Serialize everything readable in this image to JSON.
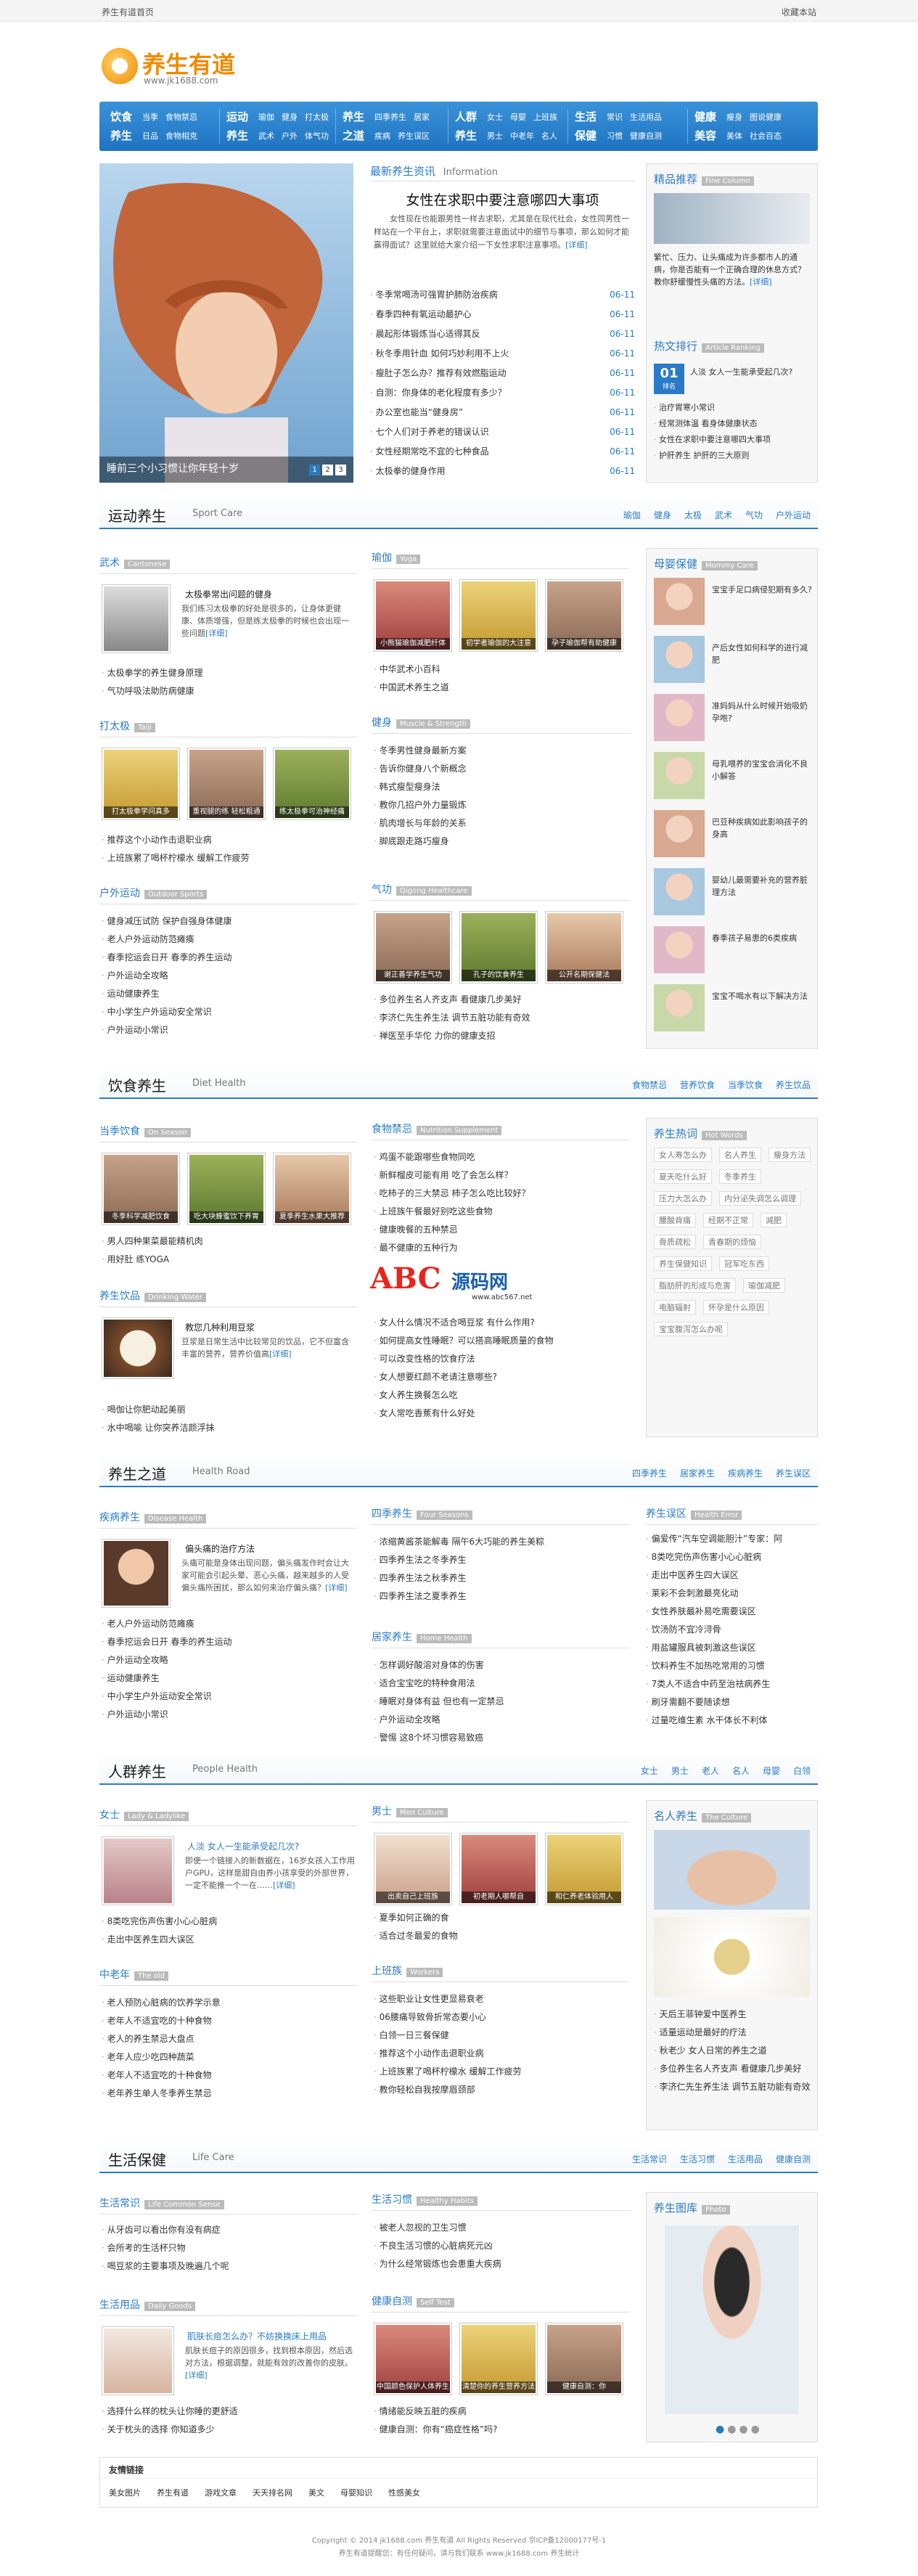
{
  "topbar": {
    "left": "养生有道首页",
    "right": "收藏本站"
  },
  "logo": {
    "name": "养生有道",
    "url": "www.jk1688.com"
  },
  "nav": [
    {
      "t1": "饮食",
      "t2": "养生",
      "i1": [
        "当季",
        "食物禁忌"
      ],
      "i2": [
        "日品",
        "食物相克"
      ]
    },
    {
      "t1": "运动",
      "t2": "养生",
      "i1": [
        "瑜伽",
        "健身",
        "打太极"
      ],
      "i2": [
        "武术",
        "户外",
        "体气功"
      ]
    },
    {
      "t1": "养生",
      "t2": "之道",
      "i1": [
        "四季养生",
        "居家"
      ],
      "i2": [
        "疾病",
        "养生误区"
      ]
    },
    {
      "t1": "人群",
      "t2": "养生",
      "i1": [
        "女士",
        "母婴",
        "上班族"
      ],
      "i2": [
        "男士",
        "中老年",
        "名人"
      ]
    },
    {
      "t1": "生活",
      "t2": "保健",
      "i1": [
        "常识",
        "生活用品"
      ],
      "i2": [
        "习惯",
        "健康自测"
      ]
    },
    {
      "t1": "健康",
      "t2": "美容",
      "i1": [
        "瘦身",
        "图说健康"
      ],
      "i2": [
        "美体",
        "社会百态"
      ]
    }
  ],
  "hero": {
    "caption": "睡前三个小习惯让你年轻十岁",
    "pages": [
      "1",
      "2",
      "3"
    ]
  },
  "latest": {
    "title": "最新养生资讯",
    "en": "Information",
    "headline": "女性在求职中要注意哪四大事项",
    "summary": "女性现在也能跟男性一样去求职，尤其是在现代社会，女性同男性一样站在一个平台上，求职就需要注意面试中的细节与事项，那么如何才能赢得面试？这里就给大家介绍一下女性求职注意事项。",
    "more": "[详细]",
    "items": [
      {
        "t": "冬季常喝汤可强胃护肺防治疾病",
        "d": "06-11"
      },
      {
        "t": "春季四种有氧运动最护心",
        "d": "06-11"
      },
      {
        "t": "晨起形体锻炼当心适得其反",
        "d": "06-11"
      },
      {
        "t": "秋冬季用针血 如何巧妙利用不上火",
        "d": "06-11"
      },
      {
        "t": "瘦肚子怎么办？推荐有效燃脂运动",
        "d": "06-11"
      },
      {
        "t": "自测：你身体的老化程度有多少？",
        "d": "06-11"
      },
      {
        "t": "办公室也能当“健身房”",
        "d": "06-11"
      },
      {
        "t": "七个人们对于养老的错误认识",
        "d": "06-11"
      },
      {
        "t": "女性经期常吃不宜的七种食品",
        "d": "06-11"
      },
      {
        "t": "太极拳的健身作用",
        "d": "06-11"
      }
    ]
  },
  "recommend": {
    "title": "精品推荐",
    "en": "Fine Column",
    "headline": "繁忙、压力、让头痛成为许多都市人的通病，你是否能有一个正确合理的休息方式？教你舒缓慢性头痛的方法。",
    "more": "[详细]"
  },
  "hot": {
    "title": "热文排行",
    "en": "Article Ranking",
    "top": {
      "num": "01",
      "label": "排名",
      "text": "人淡 女人一生能承受起几次?"
    },
    "items": [
      "治疗胃寒小常识",
      "经常测体温 看身体健康状态",
      "女性在求职中要注意哪四大事项",
      "护肝养生 护肝的三大原则"
    ]
  },
  "sport": {
    "title": "运动养生",
    "en": "Sport Care",
    "links": [
      "瑜伽",
      "健身",
      "太极",
      "武术",
      "气功",
      "户外运动"
    ],
    "wushu": {
      "h": "武术",
      "en": "Cantonese",
      "title": "太极拳常出问题的健身",
      "desc": "我们练习太极拳的好处是很多的，让身体更健康、体质增强，但是练太极拳的时候也会出现一些问题",
      "more": "[详细]",
      "items": [
        "太极拳学的养生健身原理",
        "气功呼吸法助防病健康"
      ]
    },
    "taiji": {
      "h": "打太极",
      "en": "Taiji",
      "caps": [
        "打太极拳学问真多",
        "重视腿的练 轻松粗通",
        "练太极拳可治神经痛"
      ],
      "items": [
        "推荐这个小动作击退职业病",
        "上班族累了喝杯柠檬水 缓解工作疲劳"
      ]
    },
    "outdoor": {
      "h": "户外运动",
      "en": "Outdoor Sports",
      "items": [
        "健身减压试防 保护自强身体健康",
        "老人户外运动防范瘫痪",
        "春季挖运会日开 春季的养生运动",
        "户外运动全攻略",
        "运动健康养生",
        "中小学生户外运动安全常识",
        "户外运动小常识"
      ]
    },
    "yoga": {
      "h": "瑜伽",
      "en": "Yoga",
      "caps": [
        "小熊猫瑜伽减肥纤体",
        "初学者瑜伽的大注意",
        "孕子瑜伽帮有助健康"
      ],
      "items": [
        "中华武术小百科",
        "中国武术养生之道"
      ]
    },
    "fit": {
      "h": "健身",
      "en": "Muscle & Strength",
      "items": [
        "冬季男性健身最新方案",
        "告诉你健身八个新概念",
        "韩式瘦型瘦身法",
        "教你几招户外力量锻炼",
        "肌肉增长与年龄的关系",
        "脚底跟走路巧瘦身"
      ]
    },
    "qigong": {
      "h": "气功",
      "en": "Qigong Healthcare",
      "caps": [
        "谢正善学养生气功",
        "孔子的饮食养生",
        "公开名期保健法"
      ],
      "items": [
        "多位养生名人齐支声 看健康几步美好",
        "李济仁先生养生法 调节五脏功能有奇效",
        "禅医至手华佗 力你的健康支招"
      ]
    }
  },
  "mombaby": {
    "title": "母婴保健",
    "en": "Mommy Care",
    "items": [
      "宝宝手足口病侵犯期有多久?",
      "产后女性如何科学的进行减肥",
      "准妈妈从什么时候开始吸奶孕咆?",
      "母乳喂养的宝宝会消化不良小解答",
      "巴豆种疾病如此影响孩子的身高",
      "婴幼儿最需要补充的营养脏理方法",
      "春季孩子易患的6类疾病",
      "宝宝不喝水有以下解决方法"
    ]
  },
  "diet": {
    "title": "饮食养生",
    "en": "Diet Health",
    "links": [
      "食物禁忌",
      "营养饮食",
      "当季饮食",
      "养生饮品"
    ],
    "season": {
      "h": "当季饮食",
      "en": "On Season",
      "caps": [
        "冬季科学减肥饮食",
        "吃大块蜂蜜饮下养胃",
        "夏季养生水果大推荐"
      ],
      "items": [
        "男人四种果菜最能精机肉",
        "用好肚 练YOGA"
      ]
    },
    "drink": {
      "h": "养生饮品",
      "en": "Drinking Water",
      "title": "教您几种利用豆浆",
      "desc": "豆浆是日常生活中比较常见的饮品，它不但富含丰富的营养，营养价值高",
      "more": "[详细]",
      "items": [
        "喝伽让你肥动起美丽",
        "水中喝喻 让你突养洁颜浮抹"
      ]
    },
    "taboo": {
      "h": "食物禁忌",
      "en": "Nutrition Supplement",
      "items": [
        "鸡蛋不能跟哪些食物同吃",
        "新鲜榴皮可能有用 吃了会怎么样？",
        "吃柿子的三大禁忌 柿子怎么吃比较好？",
        "上班族午餐最好别吃这些食物",
        "健康晚餐的五种禁忌",
        "最不健康的五种行为"
      ],
      "items2": [
        "女人什么情况不适合喝豆浆 有什么作用?",
        "如何提高女性睡眠？可以搭高睡眠质量的食物",
        "可以改变性格的饮食疗法",
        "女人想要红颜不老请注意哪些?",
        "女人养生换餐怎么吃",
        "女人常吃香蕉有什么好处"
      ]
    }
  },
  "hottags": {
    "title": "养生热词",
    "en": "Hot Words",
    "tags": [
      "女人寿怎么办",
      "名人养生",
      "瘦身方法",
      "夏天吃什么好",
      "冬季养生",
      "压力大怎么办",
      "内分泌失调怎么调理",
      "腰酸背痛",
      "经期不正常",
      "减肥",
      "骨质疏松",
      "青春期的烦恼",
      "养生保健知识",
      "冠军吃东西",
      "脂肪肝的形成与危害",
      "瑜伽减肥",
      "电脑辐射",
      "怀孕是什么原因",
      "宝宝腹泻怎么办呢"
    ]
  },
  "watermark": {
    "logo": "ABC",
    "cn": "源码网",
    "url": "www.abc567.net"
  },
  "road": {
    "title": "养生之道",
    "en": "Health Road",
    "links": [
      "四季养生",
      "居家养生",
      "疾病养生",
      "养生误区"
    ],
    "disease": {
      "h": "疾病养生",
      "en": "Disease Health",
      "title": "偏头痛的治疗方法",
      "desc": "头痛可能是身体出现问题，偏头痛发作时会让大家可能会引起头晕、恶心头痛，越来越多的人受偏头痛所困扰，那么如何来治疗偏头痛？",
      "more": "[详细]",
      "items": [
        "老人户外运动防范瘫痪",
        "春季挖运会日开 春季的养生运动",
        "户外运动全攻略",
        "运动健康养生",
        "中小学生户外运动安全常识",
        "户外运动小常识"
      ]
    },
    "four": {
      "h": "四季养生",
      "en": "Four Seasons",
      "items": [
        "浓缩黄酱茶能解毒 隔午6大巧能的养生美粽",
        "四季养生法之冬季养生",
        "四季养生法之秋季养生",
        "四季养生法之夏季养生"
      ]
    },
    "home": {
      "h": "居家养生",
      "en": "Home Health",
      "items": [
        "怎样调好酸溶对身体的伤害",
        "适合宝宝吃的特种食用法",
        "睡眠对身体有益 但也有一定禁忌",
        "户外运动全攻略",
        "警惕 这8个坏习惯容易致癌"
      ]
    },
    "myth": {
      "h": "养生误区",
      "en": "Health Error",
      "items": [
        "偏爱传“汽车空调能胆汁”专家：阿",
        "8类吃完伤声伤害小心心脏病",
        "走出中医养生四大误区",
        "莱彩不会刺激最亮化动",
        "女性养肤最补易吃需要误区",
        "饮汤防不宜冷浔骨",
        "用盐罐服具被刺激这些误区",
        "饮料养生不加热吃常用的习惯",
        "7类人不适合中药至治祛病养生",
        "刷牙需翻不要随读想",
        "过量吃维生素 水干体长不利体"
      ]
    }
  },
  "people": {
    "title": "人群养生",
    "en": "People Health",
    "links": [
      "女士",
      "男士",
      "老人",
      "名人",
      "母婴",
      "白领"
    ],
    "women": {
      "h": "女士",
      "en": "Lady & Ladylike",
      "title": "人淡 女人一生能承受起几次?",
      "desc": "即使一个链接入的新数据在，16岁女孩入工作用户GPU，这样是甜自由养小孩享受的外部世界，一定不能推一个一在……",
      "more": "[详细]",
      "items": [
        "8类吃完伤声伤害小心心脏病",
        "走出中医养生四大误区"
      ]
    },
    "old": {
      "h": "中老年",
      "en": "The old",
      "items": [
        "老人预防心脏病的饮养学示意",
        "老年人不适宜吃的十种食物",
        "老人的养生禁忌大盘点",
        "老年人应少吃四种蔬菜",
        "老年人不适宜吃的十种食物",
        "老年养生单人冬季养生禁忌"
      ]
    },
    "men": {
      "h": "男士",
      "en": "Men Culture",
      "caps": [
        "出卖自己上班族",
        "初老期人哪帮自",
        "和仁养老体验用人"
      ],
      "items": [
        "夏季如何正确的食",
        "适合过冬最爱的食物"
      ]
    },
    "office": {
      "h": "上班族",
      "en": "Workers",
      "items": [
        "这些职业让女性更显易衰老",
        "06腰痛导致骨折常态要小心",
        "白领一日三餐保健",
        "推荐这个小动作击退职业病",
        "上班族累了喝杯柠檬水 缓解工作疲劳",
        "教你轻松自我按摩眉颈部"
      ]
    },
    "famous": {
      "title": "名人养生",
      "en": "The Culture",
      "items": [
        "天后王菲钟爱中医养生",
        "适量运动是最好的疗法",
        "秋老少 女人日常的养生之道",
        "多位养生名人齐支声 看健康几步美好",
        "李济仁先生养生法 调节五脏功能有奇效"
      ]
    }
  },
  "life": {
    "title": "生活保健",
    "en": "Life Care",
    "links": [
      "生活常识",
      "生活习惯",
      "生活用品",
      "健康自测"
    ],
    "common": {
      "h": "生活常识",
      "en": "Life Common Sense",
      "items": [
        "从牙齿可以看出你有没有病症",
        "会所考的生活杯只物",
        "喝豆浆的主要事项及晚遍几个呢"
      ]
    },
    "goods": {
      "h": "生活用品",
      "en": "Daily Goods",
      "title": "肌肤长痘怎么办？不妨换换床上用品",
      "desc": "肌肤长痘子的原因很多，找到根本原因，然后选对方法，根据调整，就能有效的改善你的皮肤。",
      "more": "[详细]",
      "items": [
        "选择什么样的枕头让你睡的更舒适",
        "关于枕头的选择 你知道多少"
      ]
    },
    "habit": {
      "h": "生活习惯",
      "en": "Healthy Habits",
      "items": [
        "被老人忽视的卫生习惯",
        "不良生活习惯的心脏病死元凶",
        "为什么经常锻炼也会患重大疾病"
      ]
    },
    "test": {
      "h": "健康自测",
      "en": "Self Test",
      "caps": [
        "中国颜色保护人体养生",
        "清楚你的养生营养方法",
        "健康自测：你"
      ],
      "items": [
        "情绪能反映五脏的疾病",
        "健康自测：你有“癌症性格”吗?"
      ]
    },
    "gallery": {
      "title": "养生图库",
      "en": "Photo"
    }
  },
  "friendlinks": {
    "title": "友情链接",
    "items": [
      "美女图片",
      "养生有道",
      "游戏文章",
      "天天排名网",
      "美文",
      "母婴知识",
      "性感美女"
    ]
  },
  "footer": {
    "l1": "Copyright © 2014 jk1688.com 养生有道 All Rights Reserved 京ICP备12000177号-1",
    "l2": "养生有道提醒您：有任何疑问，请与我们联系 www.jk1688.com 养生统计"
  }
}
